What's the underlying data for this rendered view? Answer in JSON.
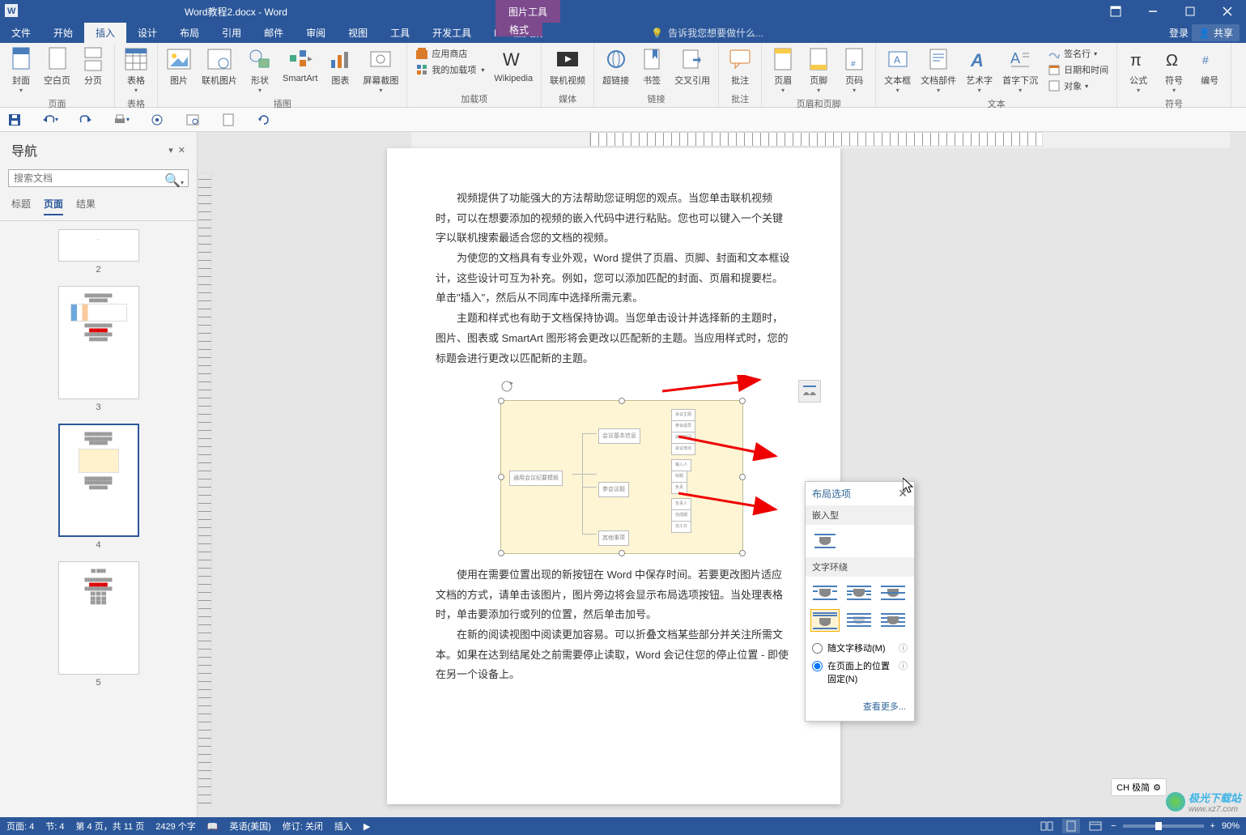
{
  "titlebar": {
    "title": "Word教程2.docx - Word",
    "context_tab": "图片工具"
  },
  "menubar": {
    "tabs": [
      "文件",
      "开始",
      "插入",
      "设计",
      "布局",
      "引用",
      "邮件",
      "审阅",
      "视图",
      "工具",
      "开发工具",
      "PDF工具集"
    ],
    "format_tab": "格式",
    "tell_me": "告诉我您想要做什么...",
    "login": "登录",
    "share": "共享"
  },
  "ribbon": {
    "groups": [
      {
        "name": "页面",
        "items": [
          "封面",
          "空白页",
          "分页"
        ]
      },
      {
        "name": "表格",
        "items": [
          "表格"
        ]
      },
      {
        "name": "插图",
        "items": [
          "图片",
          "联机图片",
          "形状",
          "SmartArt",
          "图表",
          "屏幕截图"
        ]
      },
      {
        "name": "加载项",
        "stack": [
          "应用商店",
          "我的加载项"
        ],
        "items": [
          "Wikipedia"
        ]
      },
      {
        "name": "媒体",
        "items": [
          "联机视频"
        ]
      },
      {
        "name": "链接",
        "items": [
          "超链接",
          "书签",
          "交叉引用"
        ]
      },
      {
        "name": "批注",
        "items": [
          "批注"
        ]
      },
      {
        "name": "页眉和页脚",
        "items": [
          "页眉",
          "页脚",
          "页码"
        ]
      },
      {
        "name": "文本",
        "items": [
          "文本框",
          "文档部件",
          "艺术字",
          "首字下沉"
        ],
        "stack": [
          "签名行",
          "日期和时间",
          "对象"
        ]
      },
      {
        "name": "符号",
        "items": [
          "公式",
          "符号",
          "编号"
        ]
      }
    ]
  },
  "navpane": {
    "title": "导航",
    "search_placeholder": "搜索文档",
    "tabs": [
      "标题",
      "页面",
      "结果"
    ],
    "pages": [
      "2",
      "3",
      "4",
      "5"
    ]
  },
  "document": {
    "paragraphs": [
      "视频提供了功能强大的方法帮助您证明您的观点。当您单击联机视频时，可以在想要添加的视频的嵌入代码中进行粘贴。您也可以键入一个关键字以联机搜索最适合您的文档的视频。",
      "为使您的文档具有专业外观，Word 提供了页眉、页脚、封面和文本框设计，这些设计可互为补充。例如，您可以添加匹配的封面、页眉和提要栏。单击\"插入\"，然后从不同库中选择所需元素。",
      "主题和样式也有助于文档保持协调。当您单击设计并选择新的主题时，图片、图表或 SmartArt 图形将会更改以匹配新的主题。当应用样式时，您的标题会进行更改以匹配新的主题。",
      "使用在需要位置出现的新按钮在 Word 中保存时间。若要更改图片适应文档的方式，请单击该图片，图片旁边将会显示布局选项按钮。当处理表格时，单击要添加行或列的位置，然后单击加号。",
      "在新的阅读视图中阅读更加容易。可以折叠文档某些部分并关注所需文本。如果在达到结尾处之前需要停止读取，Word 会记住您的停止位置 - 即使在另一个设备上。"
    ],
    "diagram_labels": {
      "root": "通用会议纪要模板",
      "b1": "会议基本信息",
      "b2": "参会议题",
      "b3": "其他事项"
    }
  },
  "layout_popup": {
    "title": "布局选项",
    "section1": "嵌入型",
    "section2": "文字环绕",
    "radio1": "随文字移动(M)",
    "radio2_a": "在页面上的位置",
    "radio2_b": "固定(N)",
    "more": "查看更多..."
  },
  "statusbar": {
    "page": "页面: 4",
    "section": "节: 4",
    "pages": "第 4 页，共 11 页",
    "words": "2429 个字",
    "lang": "英语(美国)",
    "track": "修订: 关闭",
    "insert": "插入",
    "zoom": "90%"
  },
  "ch_badge": "CH 极简",
  "watermark": {
    "name": "极光下载站",
    "url": "www.xz7.com"
  }
}
